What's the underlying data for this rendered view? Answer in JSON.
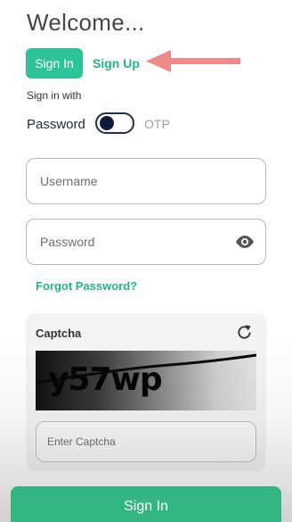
{
  "header": {
    "title": "Welcome..."
  },
  "tabs": {
    "sign_in": "Sign In",
    "sign_up": "Sign Up"
  },
  "login_mode": {
    "label": "Sign in with",
    "password_option": "Password",
    "otp_option": "OTP",
    "otp_selected": false
  },
  "form": {
    "username_placeholder": "Username",
    "password_placeholder": "Password",
    "forgot_password": "Forgot Password?"
  },
  "captcha": {
    "label": "Captcha",
    "code": "y57wp",
    "input_placeholder": "Enter Captcha"
  },
  "submit": {
    "label": "Sign In"
  },
  "colors": {
    "accent": "#2ec49a",
    "link": "#22b58b",
    "submit": "#33b67f",
    "arrow": "#ee8a8a"
  },
  "icons": {
    "password_toggle": "eye-icon",
    "captcha_refresh": "refresh-icon",
    "pointer": "arrow-left-icon"
  }
}
